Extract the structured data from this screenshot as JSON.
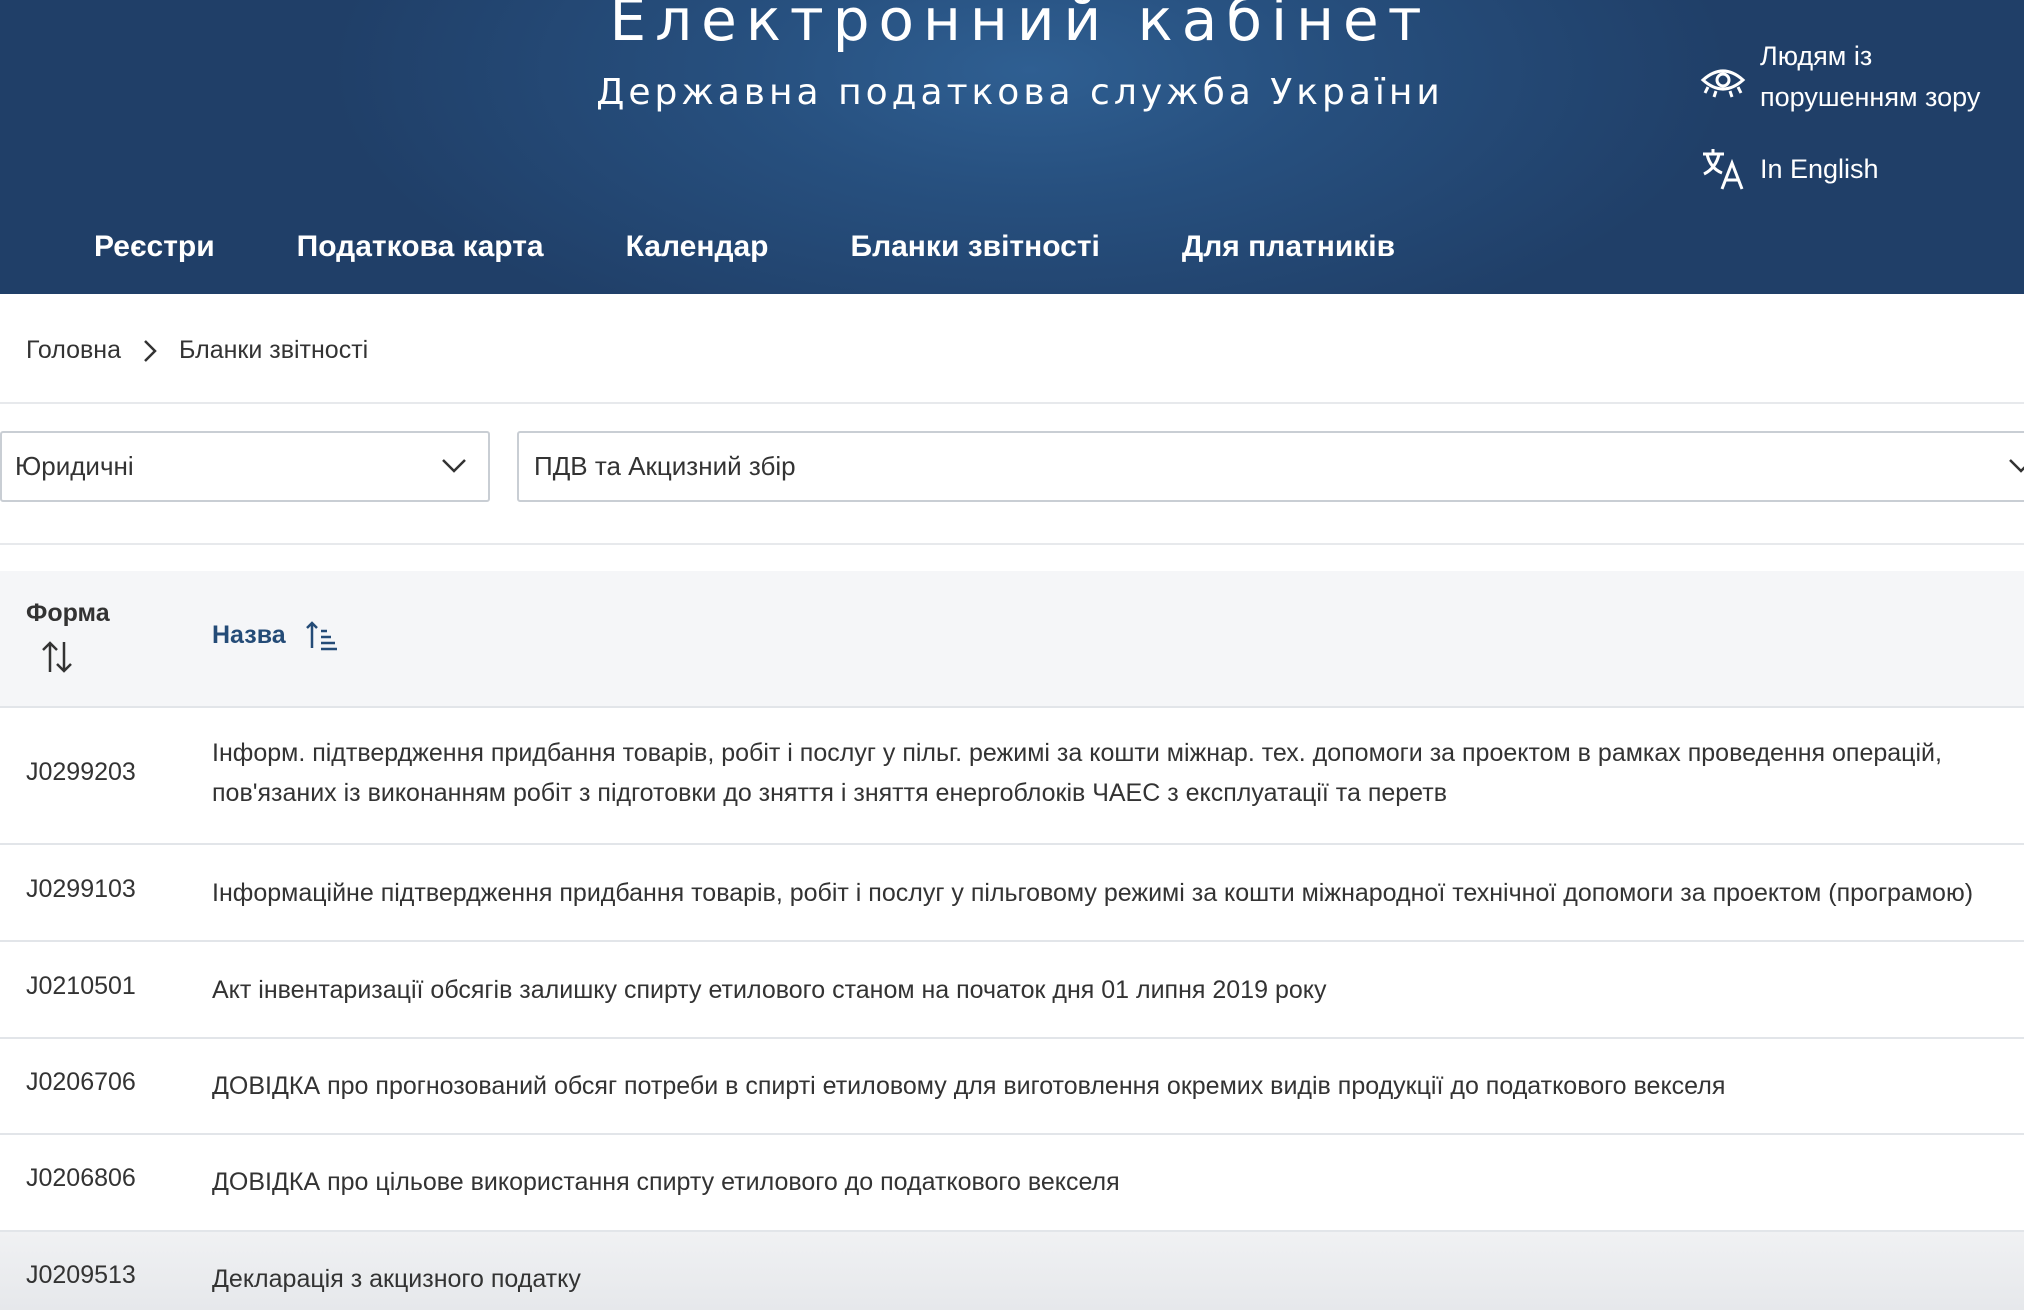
{
  "header": {
    "title": "Електронний кабінет",
    "subtitle": "Державна податкова служба України",
    "accessibility_label": "Людям із порушенням зору",
    "language_label": "In English"
  },
  "nav": {
    "items": [
      {
        "label": "Реєстри"
      },
      {
        "label": "Податкова карта"
      },
      {
        "label": "Календар"
      },
      {
        "label": "Бланки звітності"
      },
      {
        "label": "Для платників"
      }
    ]
  },
  "breadcrumb": {
    "home": "Головна",
    "current": "Бланки звітності"
  },
  "filters": {
    "payer_type": "Юридичні",
    "category": "ПДВ та Акцизний збір"
  },
  "table": {
    "columns": {
      "form": "Форма",
      "name": "Назва"
    },
    "rows": [
      {
        "code": "J0299203",
        "name": "Інформ. підтвердження придбання товарів, робіт і послуг у пільг. режимі за кошти міжнар. тех. допомоги за проектом в рамках проведення операцій, пов'язаних із виконанням робіт з підготовки до зняття і зняття енергоблоків ЧАЕС з експлуатації та перетв"
      },
      {
        "code": "J0299103",
        "name": "Інформаційне підтвердження придбання товарів, робіт і послуг у пільговому режимі за кошти міжнародної технічної допомоги за проектом (програмою)"
      },
      {
        "code": "J0210501",
        "name": "Акт інвентаризації обсягів залишку спирту етилового станом на початок дня 01 липня 2019 року"
      },
      {
        "code": "J0206706",
        "name": "ДОВІДКА про прогнозований обсяг потреби в спирті етиловому для виготовлення окремих видів продукції до податкового векселя"
      },
      {
        "code": "J0206806",
        "name": "ДОВІДКА про цільове використання спирту етилового до податкового векселя"
      },
      {
        "code": "J0209513",
        "name": "Декларація з акцизного податку"
      }
    ]
  },
  "colors": {
    "header_bg": "#27507f",
    "accent_link": "#244b77",
    "border": "#e2e5e9"
  }
}
